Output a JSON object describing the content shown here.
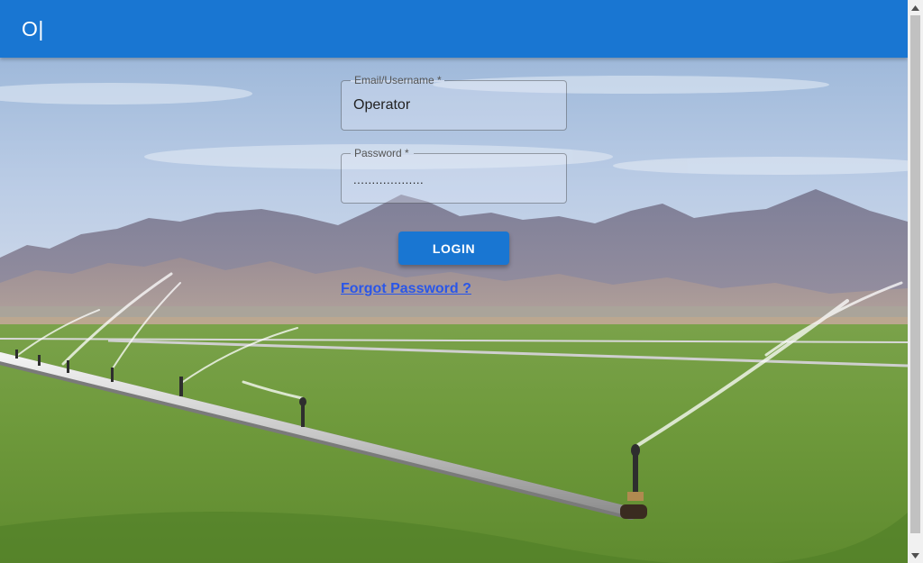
{
  "app_bar": {
    "title": "O|",
    "color": "#1976d2"
  },
  "login": {
    "username": {
      "label": "Email/Username *",
      "value": "Operator",
      "placeholder": ""
    },
    "password": {
      "label": "Password *",
      "value": "..................."
    },
    "submit_label": "LOGIN",
    "forgot_password_label": "Forgot Password ?"
  },
  "background": {
    "scene": "mountain-irrigation-field"
  },
  "icons": {
    "scroll_up": "triangle-up-icon",
    "scroll_down": "triangle-down-icon"
  }
}
